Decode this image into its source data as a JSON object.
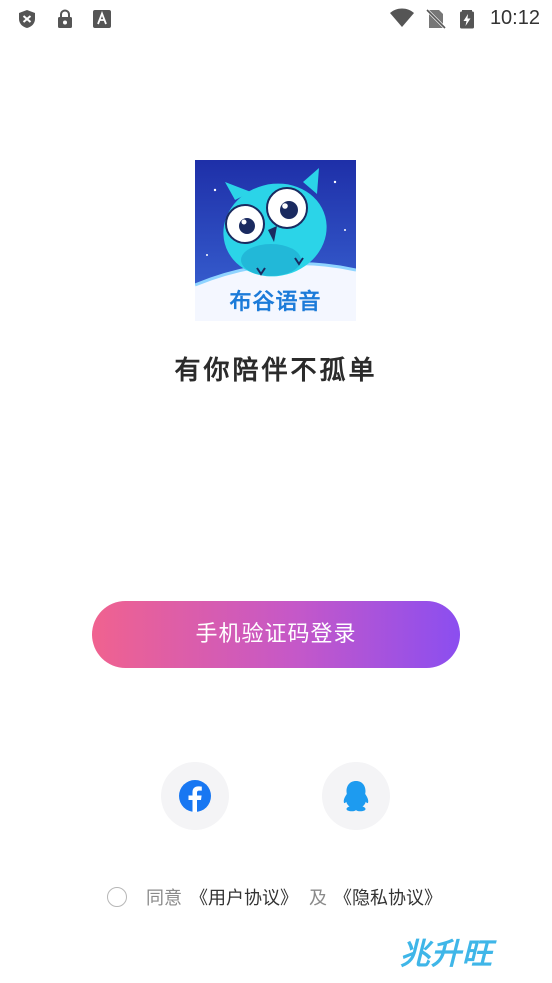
{
  "status_bar": {
    "time": "10:12"
  },
  "logo": {
    "brand_text": "布谷语音"
  },
  "slogan": "有你陪伴不孤单",
  "login": {
    "phone_button_label": "手机验证码登录"
  },
  "social_login": [
    {
      "name": "facebook",
      "icon": "facebook-icon",
      "color": "#1877f2"
    },
    {
      "name": "qq",
      "icon": "qq-penguin-icon",
      "color": "#1d9bf0"
    }
  ],
  "agreement": {
    "prefix": "同意",
    "user_agreement": "《用户协议》",
    "conjunction": "及",
    "privacy_policy": "《隐私协议》"
  },
  "watermark": {
    "text": "兆升旺"
  },
  "colors": {
    "gradient_start": "#f0628f",
    "gradient_end": "#8b4ef0",
    "brand_blue": "#1c7bd9"
  }
}
